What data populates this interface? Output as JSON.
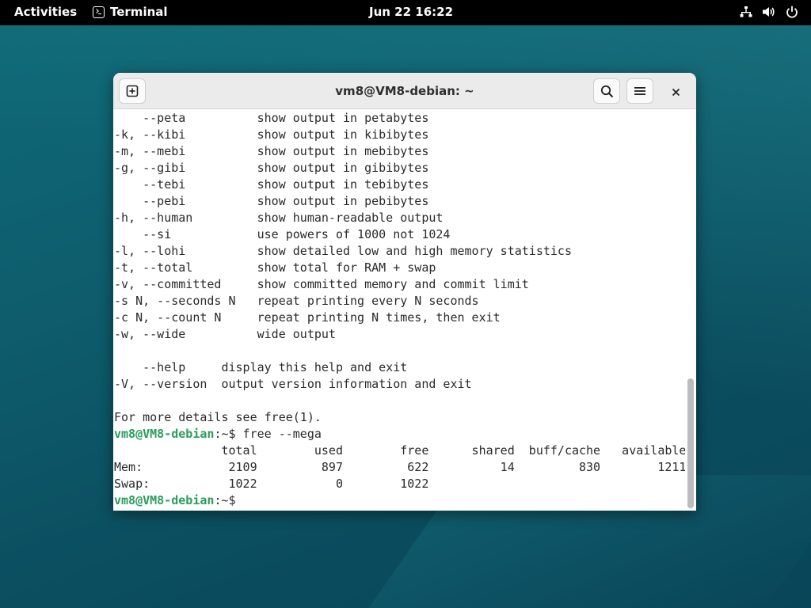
{
  "topbar": {
    "activities": "Activities",
    "app_name": "Terminal",
    "clock": "Jun 22  16:22",
    "tray_icons": [
      "network-icon",
      "volume-icon",
      "power-icon"
    ]
  },
  "window": {
    "title": "vm8@VM8-debian: ~",
    "buttons": [
      "new-tab-icon",
      "search-icon",
      "menu-icon",
      "close-icon"
    ]
  },
  "terminal": {
    "help_lines": [
      "    --peta          show output in petabytes",
      "-k, --kibi          show output in kibibytes",
      "-m, --mebi          show output in mebibytes",
      "-g, --gibi          show output in gibibytes",
      "    --tebi          show output in tebibytes",
      "    --pebi          show output in pebibytes",
      "-h, --human         show human-readable output",
      "    --si            use powers of 1000 not 1024",
      "-l, --lohi          show detailed low and high memory statistics",
      "-t, --total         show total for RAM + swap",
      "-v, --committed     show committed memory and commit limit",
      "-s N, --seconds N   repeat printing every N seconds",
      "-c N, --count N     repeat printing N times, then exit",
      "-w, --wide          wide output",
      "",
      "    --help     display this help and exit",
      "-V, --version  output version information and exit",
      "",
      "For more details see free(1)."
    ],
    "prompt_user": "vm8@VM8-debian",
    "prompt_suffix": ":~$",
    "command": " free --mega",
    "table_header": "               total        used        free      shared  buff/cache   available",
    "table_rows": [
      "Mem:            2109         897         622          14         830        1211",
      "Swap:           1022           0        1022"
    ],
    "final_prompt_user": "vm8@VM8-debian",
    "final_prompt_suffix": ":~$"
  }
}
